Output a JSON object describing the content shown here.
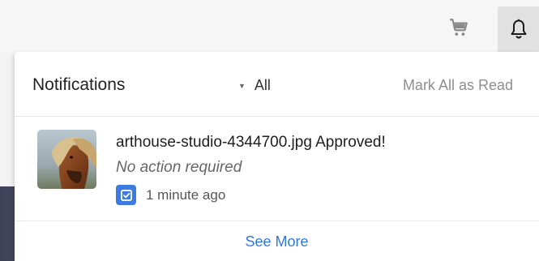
{
  "topbar": {
    "cart_icon": "cart-icon",
    "bell_icon": "bell-icon"
  },
  "notifications": {
    "title": "Notifications",
    "filter_value": "All",
    "filter_icon": "caret-down-icon",
    "mark_all_label": "Mark All as Read",
    "see_more_label": "See More",
    "items": [
      {
        "title": "arthouse-studio-4344700.jpg Approved!",
        "subtitle": "No action required",
        "time": "1 minute ago",
        "thumbnail": "horse-photo",
        "status_icon": "approved-check-icon"
      }
    ]
  },
  "colors": {
    "accent": "#2f78d8",
    "status_icon_bg": "#3d7be0",
    "bell_button_bg": "#e1e1e1"
  }
}
